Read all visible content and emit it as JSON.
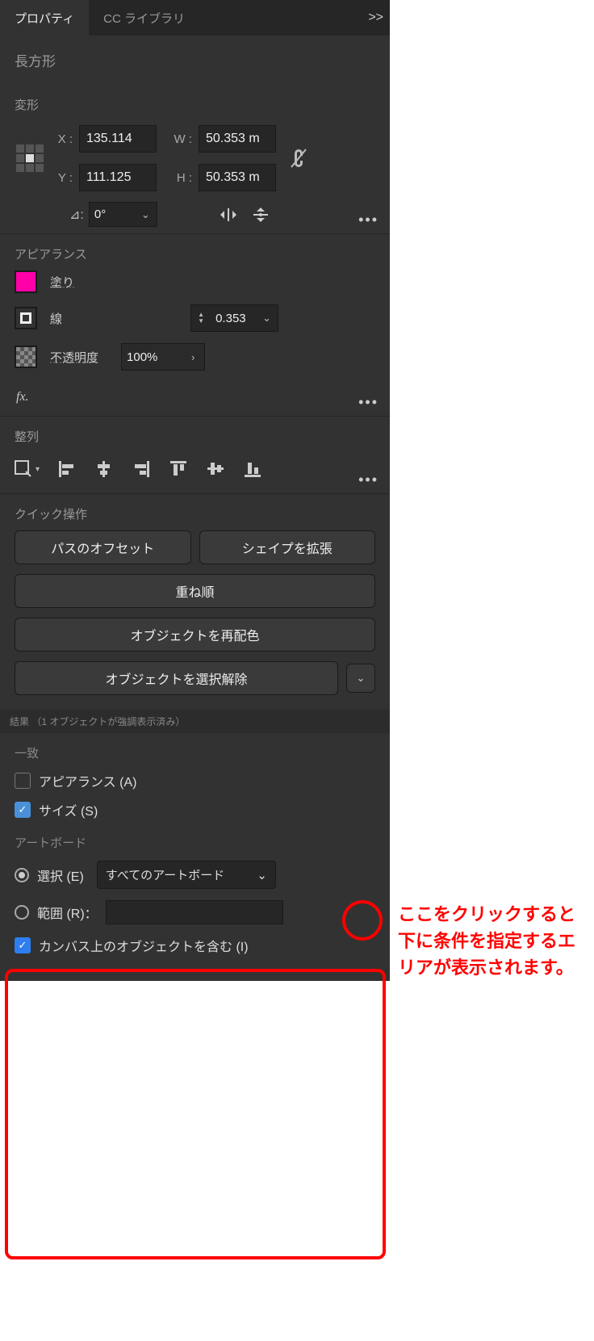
{
  "tabs": {
    "properties": "プロパティ",
    "ccLibraries": "CC ライブラリ",
    "more": ">>"
  },
  "selection": {
    "name": "長方形"
  },
  "transform": {
    "title": "変形",
    "xLabel": "X :",
    "xValue": "135.114",
    "wLabel": "W :",
    "wValue": "50.353 m",
    "yLabel": "Y :",
    "yValue": "111.125",
    "hLabel": "H :",
    "hValue": "50.353 m",
    "rotateValue": "0°"
  },
  "appearance": {
    "title": "アピアランス",
    "fillLabel": "塗り",
    "fillColor": "#ff00a8",
    "strokeLabel": "線",
    "strokeValue": "0.353",
    "opacityLabel": "不透明度",
    "opacityValue": "100%",
    "fxLabel": "fx."
  },
  "align": {
    "title": "整列"
  },
  "quick": {
    "title": "クイック操作",
    "offsetPath": "パスのオフセット",
    "expandShape": "シェイプを拡張",
    "arrange": "重ね順",
    "recolor": "オブジェクトを再配色",
    "deselect": "オブジェクトを選択解除"
  },
  "result": {
    "text": "結果 （1 オブジェクトが強調表示済み）"
  },
  "criteria": {
    "matchTitle": "一致",
    "appearance": "アピアランス (A)",
    "size": "サイズ (S)",
    "artboardTitle": "アートボード",
    "selectLabel": "選択 (E)",
    "allArtboards": "すべてのアートボード",
    "rangeLabel": "範囲 (R)：",
    "includeCanvas": "カンバス上のオブジェクトを含む (I)"
  },
  "callout": "ここをクリックすると下に条件を指定するエリアが表示されます。",
  "ellipsis": "•••"
}
